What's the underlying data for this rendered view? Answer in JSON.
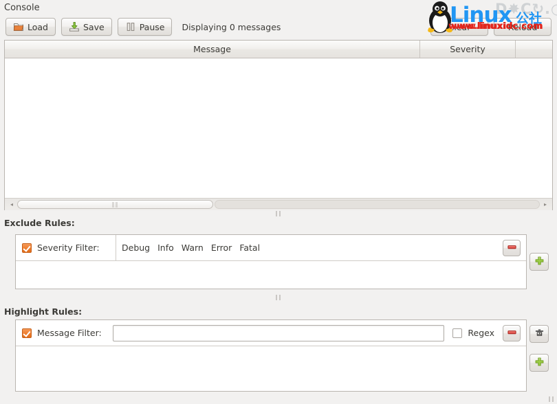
{
  "window": {
    "title": "Console"
  },
  "toolbar": {
    "load_label": "Load",
    "save_label": "Save",
    "pause_label": "Pause",
    "status_text": "Displaying 0 messages",
    "clear_label": "Clear",
    "reload_label": "Reload"
  },
  "message_table": {
    "columns": [
      {
        "label": "Message"
      },
      {
        "label": "Severity"
      }
    ],
    "rows": []
  },
  "scrollbar": {
    "left_arrow": "◂",
    "right_arrow": "▸",
    "grip": "‖‖"
  },
  "splitter": {
    "grip": "‖‖"
  },
  "exclude_rules": {
    "title": "Exclude Rules:",
    "rows": [
      {
        "enabled": true,
        "label": "Severity Filter:",
        "values": [
          "Debug",
          "Info",
          "Warn",
          "Error",
          "Fatal"
        ]
      }
    ],
    "remove_button": "remove-rule-button",
    "add_button": "add-rule-button"
  },
  "highlight_rules": {
    "title": "Highlight Rules:",
    "rows": [
      {
        "enabled": true,
        "label": "Message Filter:",
        "input_value": "",
        "input_placeholder": "",
        "regex_label": "Regex",
        "regex_enabled": false
      }
    ],
    "remove_button": "remove-rule-button",
    "color_button": "color-picker-button",
    "add_button": "add-rule-button"
  },
  "watermark": {
    "brand": "Linux",
    "brand_cn": "公社",
    "url_primary": "www.linuxidc.com",
    "url_secondary": "www.linuxidc.com",
    "ghost": "D✸C↻.○"
  },
  "colors": {
    "accent_orange": "#ef7e2e",
    "brand_blue": "#2196f3",
    "brand_red": "#e2231a",
    "window_bg": "#f2f1f0",
    "text": "#3c3b37"
  }
}
